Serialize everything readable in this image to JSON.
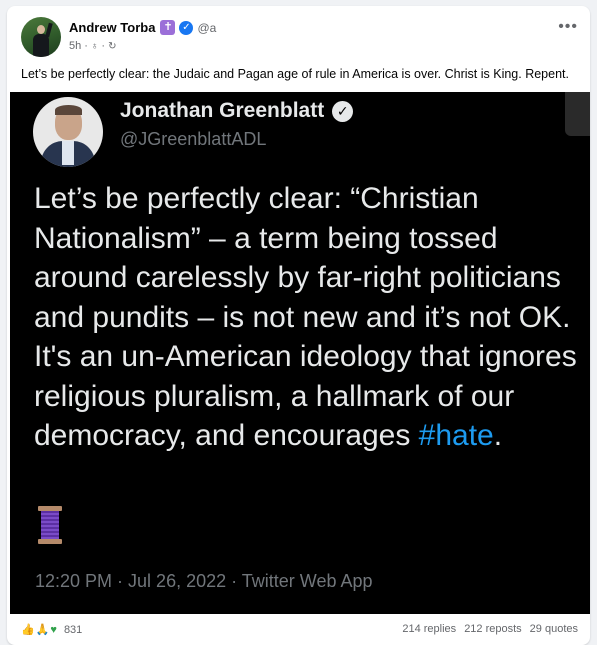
{
  "post": {
    "author": "Andrew Torba",
    "handle": "@a",
    "time": "5h",
    "caption": "Let’s be perfectly clear: the Judaic and Pagan age of rule in America is over. Christ is King. Repent.",
    "icons": {
      "more": "more-options-icon",
      "cross_badge": "cross-badge-icon",
      "verified": "verified-icon",
      "audience": "globe-icon",
      "edited": "edit-icon"
    }
  },
  "embedded_tweet": {
    "name": "Jonathan Greenblatt",
    "handle": "@JGreenblattADL",
    "text_main": "Let’s be perfectly clear: “Christian Nationalism” – a term being tossed around carelessly by far-right politicians and pundits – is not new and it’s not OK. It's an un-American ideology that ignores religious pluralism, a hallmark of our democracy, and encourages ",
    "hashtag": "#hate",
    "text_end": ".",
    "timestamp": "12:20 PM · Jul 26, 2022 · Twitter Web App",
    "emoji": "spool-of-thread-icon"
  },
  "footer": {
    "reaction_count": "831",
    "replies": "214 replies",
    "reposts": "212 reposts",
    "quotes": "29 quotes"
  },
  "colors": {
    "accent": "#1877f2",
    "hashtag": "#1d9bf0",
    "tweet_bg": "#000000",
    "cross_badge": "#9b6fd8"
  }
}
